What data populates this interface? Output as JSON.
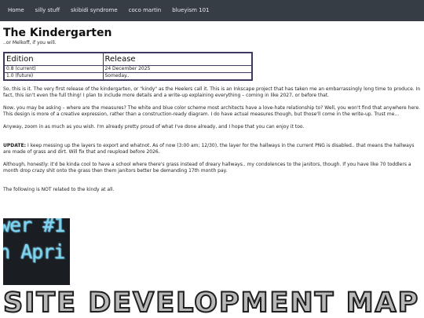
{
  "nav": {
    "items": [
      "Home",
      "silly stuff",
      "skibidi syndrome",
      "coco martin",
      "blueyism 101"
    ]
  },
  "page": {
    "title": "The Kindergarten",
    "subtitle": "..or Melkoff, if you will."
  },
  "table": {
    "headers": [
      "Edition",
      "Release"
    ],
    "rows": [
      [
        "0.8 (current)",
        "24 December 2025"
      ],
      [
        "1.0 (future)",
        "Someday.."
      ]
    ]
  },
  "paragraphs": {
    "intro": "So, this is it. The very first release of the kindergarten, or \"kindy\" as the Heelers call it. This is an Inkscape project that has taken me an embarrassingly long time to produce. In fact, this isn't even the full thing! I plan to include more details and a write-up explaining everything – coming in like 2027, or before that.",
    "measures": "Now, you may be asking – where are the measures? The white and blue color scheme most architects have a love-hate relationship to? Well, you won't find that anywhere here. This design is more of a creative expression, rather than a construction-ready diagram. I do have actual measures though, but those'll come in the write-up. Trust me...",
    "zoom": "Anyway, zoom in as much as you wish. I'm already pretty proud of what I've done already, and I hope that you can enjoy it too.",
    "update_label": "UPDATE:",
    "update": " I keep messing up the layers to export and whatnot. As of now (3:00 am; 12/30), the layer for the hallways in the current PNG is disabled.. that means the hallways are made of grass and dirt. Will fix that and reupload before 2026.",
    "honestly": "Although, honestly: it'd be kinda cool to have a school where there's grass instead of dreary hallways.. my condolences to the janitors, though. If you have like 70 toddlers a month drop crazy shit onto the grass then them janitors better be demanding 17th month pay.",
    "not_related": "The following is NOT related to the kindy at all."
  },
  "gif": {
    "line1": "wer #1",
    "line2": "n Apri"
  },
  "site_map": {
    "title": "SITE DEVELOPMENT MAP"
  }
}
